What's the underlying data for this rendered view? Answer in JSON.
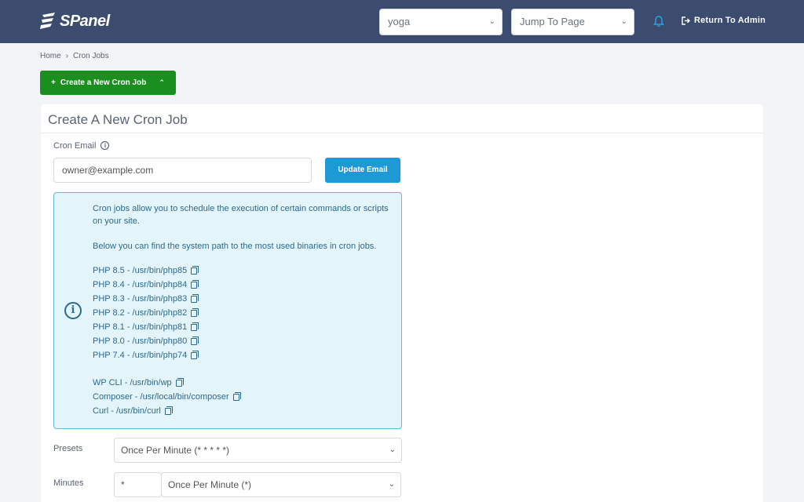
{
  "header": {
    "logo_text": "SPanel",
    "site_select": "yoga",
    "jump_select": "Jump To Page",
    "return_label": "Return To Admin"
  },
  "breadcrumb": {
    "home": "Home",
    "current": "Cron Jobs"
  },
  "create_button": "Create a New Cron Job",
  "card": {
    "title": "Create A New Cron Job",
    "email_label": "Cron Email",
    "email_value": "owner@example.com",
    "update_email": "Update Email",
    "info_text_1": "Cron jobs allow you to schedule the execution of certain commands or scripts on your site.",
    "info_text_2": "Below you can find the system path to the most used binaries in cron jobs.",
    "php_paths": [
      "PHP 8.5 - /usr/bin/php85",
      "PHP 8.4 - /usr/bin/php84",
      "PHP 8.3 - /usr/bin/php83",
      "PHP 8.2 - /usr/bin/php82",
      "PHP 8.1 - /usr/bin/php81",
      "PHP 8.0 - /usr/bin/php80",
      "PHP 7.4 - /usr/bin/php74"
    ],
    "tool_paths": [
      "WP CLI - /usr/bin/wp",
      "Composer - /usr/local/bin/composer",
      "Curl - /usr/bin/curl"
    ],
    "presets_label": "Presets",
    "presets_value": "Once Per Minute (* * * * *)",
    "minutes_label": "Minutes",
    "minutes_value": "*",
    "minutes_select": "Once Per Minute (*)"
  },
  "colors": {
    "header_bg": "#3b4c6e",
    "create_green": "#1a8f1f",
    "update_blue": "#1d9ad6",
    "alert_bg": "#e4f4fb"
  }
}
